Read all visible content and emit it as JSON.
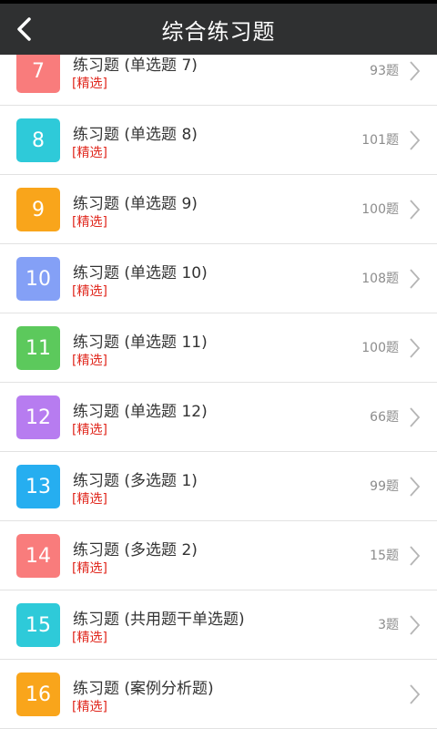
{
  "header": {
    "title": "综合练习题"
  },
  "items": [
    {
      "num": "7",
      "name": "练习题 (单选题 7)",
      "tag": "[精选]",
      "count": "93题",
      "color": "#f97c7c"
    },
    {
      "num": "8",
      "name": "练习题 (单选题 8)",
      "tag": "[精选]",
      "count": "101题",
      "color": "#2ecad9"
    },
    {
      "num": "9",
      "name": "练习题 (单选题 9)",
      "tag": "[精选]",
      "count": "100题",
      "color": "#f9a51b"
    },
    {
      "num": "10",
      "name": "练习题 (单选题 10)",
      "tag": "[精选]",
      "count": "108题",
      "color": "#84a0f6"
    },
    {
      "num": "11",
      "name": "练习题 (单选题 11)",
      "tag": "[精选]",
      "count": "100题",
      "color": "#5cc95c"
    },
    {
      "num": "12",
      "name": "练习题 (单选题 12)",
      "tag": "[精选]",
      "count": "66题",
      "color": "#b77cf0"
    },
    {
      "num": "13",
      "name": "练习题 (多选题 1)",
      "tag": "[精选]",
      "count": "99题",
      "color": "#26aef0"
    },
    {
      "num": "14",
      "name": "练习题 (多选题 2)",
      "tag": "[精选]",
      "count": "15题",
      "color": "#f97c7c"
    },
    {
      "num": "15",
      "name": "练习题 (共用题干单选题)",
      "tag": "[精选]",
      "count": "3题",
      "color": "#2ecad9"
    },
    {
      "num": "16",
      "name": "练习题 (案例分析题)",
      "tag": "[精选]",
      "count": "",
      "color": "#f9a51b"
    }
  ]
}
